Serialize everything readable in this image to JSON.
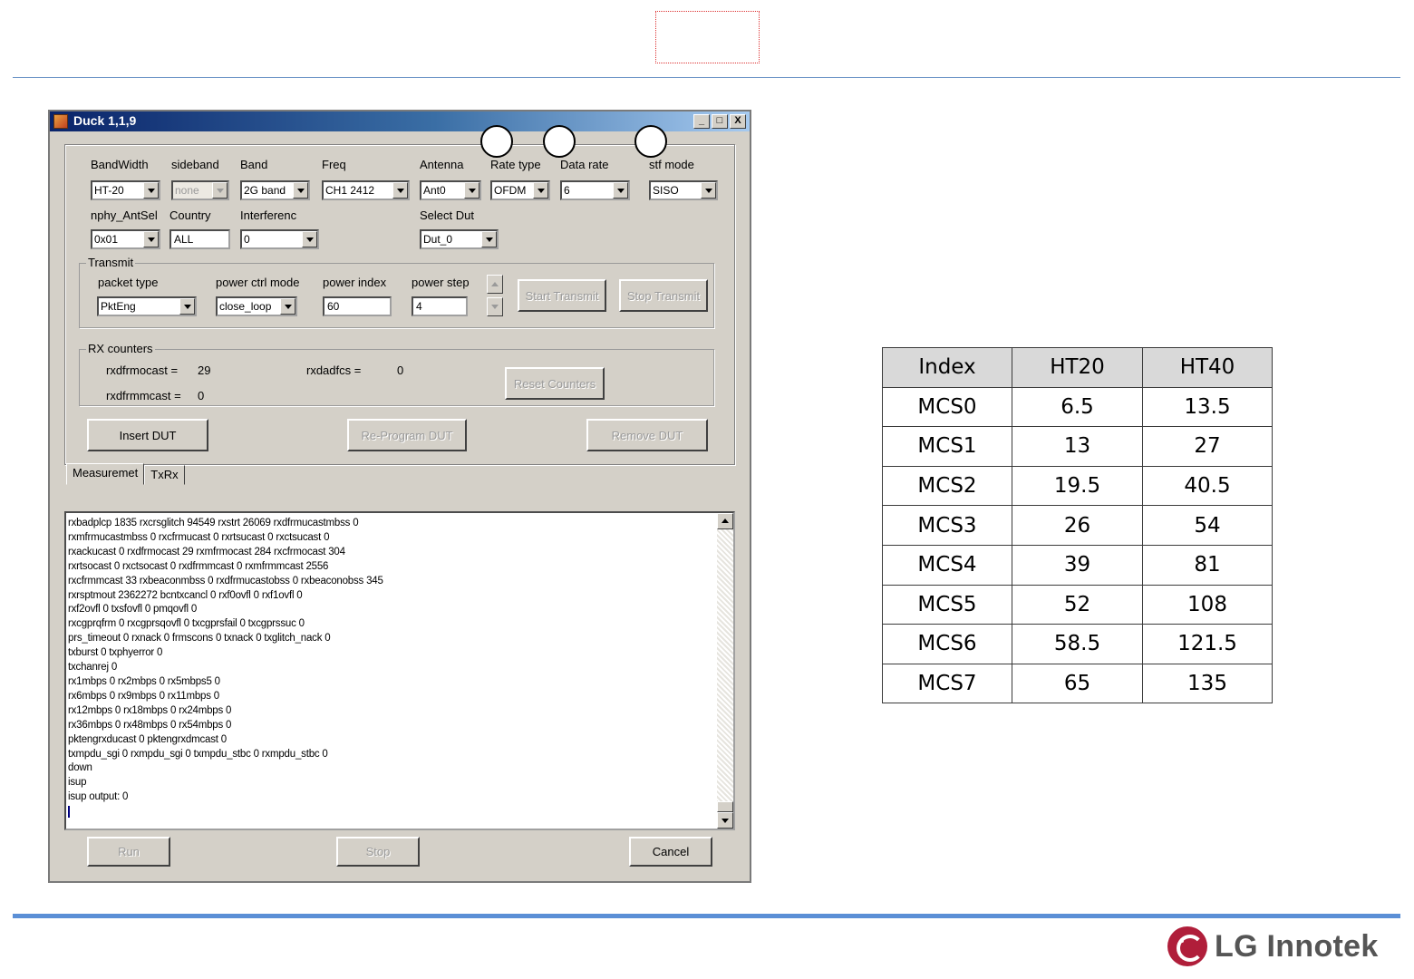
{
  "window": {
    "title": "Duck 1,1,9",
    "controls": {
      "minimize": "_",
      "maximize": "□",
      "close": "X"
    }
  },
  "settings": {
    "bandwidth": {
      "label": "BandWidth",
      "value": "HT-20"
    },
    "sideband": {
      "label": "sideband",
      "value": "none"
    },
    "band": {
      "label": "Band",
      "value": "2G band"
    },
    "freq": {
      "label": "Freq",
      "value": "CH1 2412"
    },
    "antenna": {
      "label": "Antenna",
      "value": "Ant0"
    },
    "rate_type": {
      "label": "Rate type",
      "value": "OFDM"
    },
    "data_rate": {
      "label": "Data rate",
      "value": "6"
    },
    "stf_mode": {
      "label": "stf mode",
      "value": "SISO"
    },
    "nphy_antsel": {
      "label": "nphy_AntSel",
      "value": "0x01"
    },
    "country": {
      "label": "Country",
      "value": "ALL"
    },
    "interference": {
      "label": "Interferenc",
      "value": "0"
    },
    "select_dut": {
      "label": "Select Dut",
      "value": "Dut_0"
    }
  },
  "transmit": {
    "legend": "Transmit",
    "packet_type": {
      "label": "packet type",
      "value": "PktEng"
    },
    "power_ctrl_mode": {
      "label": "power ctrl mode",
      "value": "close_loop"
    },
    "power_index": {
      "label": "power index",
      "value": "60"
    },
    "power_step": {
      "label": "power step",
      "value": "4"
    },
    "start_button": "Start Transmit",
    "stop_button": "Stop Transmit"
  },
  "rx_counters": {
    "legend": "RX counters",
    "rxdfrmocast_label": "rxdfrmocast =",
    "rxdfrmocast_value": "29",
    "rxdadfcs_label": "rxdadfcs =",
    "rxdadfcs_value": "0",
    "rxdfrmmcast_label": "rxdfrmmcast =",
    "rxdfrmmcast_value": "0",
    "reset_button": "Reset Counters"
  },
  "dut_buttons": {
    "insert": "Insert DUT",
    "reprogram": "Re-Program DUT",
    "remove": "Remove DUT"
  },
  "tabs": [
    {
      "label": "Measuremet"
    },
    {
      "label": "TxRx"
    }
  ],
  "console_lines": [
    "rxbadplcp 1835 rxcrsglitch 94549 rxstrt 26069 rxdfrmucastmbss 0",
    "rxmfrmucastmbss 0 rxcfrmucast 0 rxrtsucast 0 rxctsucast 0",
    "rxackucast 0 rxdfrmocast 29 rxmfrmocast 284 rxcfrmocast 304",
    "rxrtsocast 0 rxctsocast 0 rxdfrmmcast 0 rxmfrmmcast 2556",
    "rxcfrmmcast 33 rxbeaconmbss 0 rxdfrmucastobss 0 rxbeaconobss 345",
    "rxrsptmout 2362272 bcntxcancl 0 rxf0ovfl 0 rxf1ovfl 0",
    "rxf2ovfl 0 txsfovfl 0 pmqovfl 0",
    "rxcgprqfrm 0 rxcgprsqovfl 0 txcgprsfail 0 txcgprssuc 0",
    "prs_timeout 0 rxnack 0 frmscons 0 txnack 0 txglitch_nack 0",
    "txburst 0 txphyerror 0",
    "txchanrej 0",
    "rx1mbps 0 rx2mbps 0 rx5mbps5 0",
    "rx6mbps 0 rx9mbps 0 rx11mbps 0",
    "rx12mbps 0 rx18mbps 0 rx24mbps 0",
    "rx36mbps 0 rx48mbps 0 rx54mbps 0",
    "pktengrxducast 0 pktengrxdmcast 0",
    "txmpdu_sgi 0 rxmpdu_sgi 0 txmpdu_stbc 0 rxmpdu_stbc 0",
    "down",
    "isup",
    "isup output: 0"
  ],
  "bottom_buttons": {
    "run": "Run",
    "stop": "Stop",
    "cancel": "Cancel"
  },
  "mcs_table": {
    "headers": [
      "Index",
      "HT20",
      "HT40"
    ],
    "rows": [
      [
        "MCS0",
        "6.5",
        "13.5"
      ],
      [
        "MCS1",
        "13",
        "27"
      ],
      [
        "MCS2",
        "19.5",
        "40.5"
      ],
      [
        "MCS3",
        "26",
        "54"
      ],
      [
        "MCS4",
        "39",
        "81"
      ],
      [
        "MCS5",
        "52",
        "108"
      ],
      [
        "MCS6",
        "58.5",
        "121.5"
      ],
      [
        "MCS7",
        "65",
        "135"
      ]
    ]
  },
  "logo": {
    "text": "LG Innotek",
    "brand_color": "#b01e3a"
  },
  "colors": {
    "title_bar_start": "#0a246a",
    "title_bar_end": "#a6caf0",
    "rule_blue": "#5b8fd6"
  }
}
